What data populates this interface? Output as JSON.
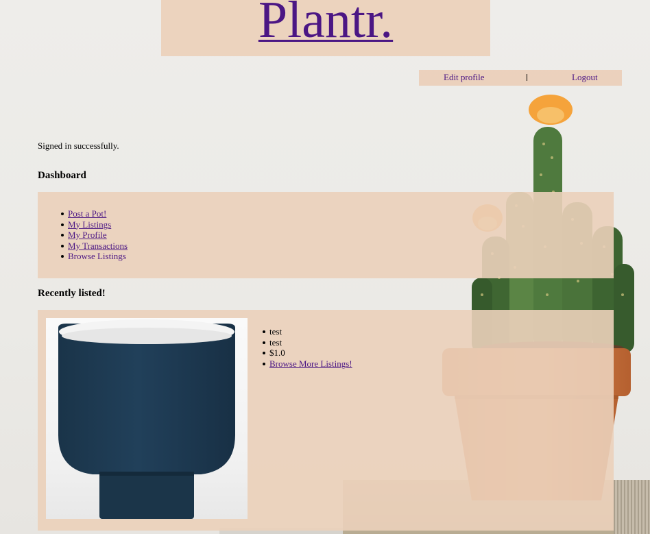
{
  "brand": {
    "name": "Plantr."
  },
  "user_nav": {
    "edit_profile": "Edit profile",
    "logout": "Logout"
  },
  "flash": {
    "message": "Signed in successfully."
  },
  "dashboard": {
    "title": "Dashboard",
    "links": [
      {
        "label": "Post a Pot!"
      },
      {
        "label": "My Listings"
      },
      {
        "label": "My Profile"
      },
      {
        "label": "My Transactions"
      },
      {
        "label": "Browse Listings"
      }
    ]
  },
  "recent": {
    "title": "Recently listed!",
    "listing": {
      "name": "test",
      "description": "test",
      "price": "$1.0",
      "more_link": "Browse More Listings!"
    }
  },
  "colors": {
    "panel": "#ebd0ba",
    "link": "#4b1684",
    "pot_blue": "#1e3a52"
  },
  "icons": {
    "background": "cactus-on-books-photo",
    "listing_image": "blue-planter-pot-photo"
  }
}
